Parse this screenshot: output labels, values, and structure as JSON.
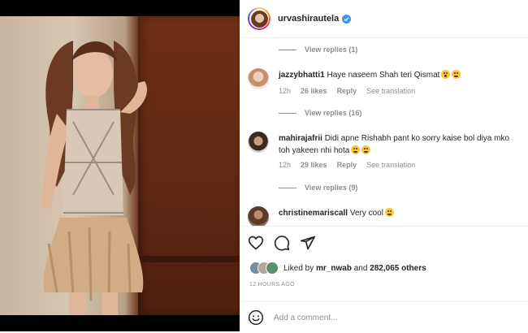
{
  "post": {
    "username": "urvashirautela",
    "verified": true,
    "liked_by_prefix": "Liked by",
    "liked_by_user": "mr_nwab",
    "liked_by_and": "and",
    "liked_by_others": "282,065 others",
    "timestamp": "12 HOURS AGO"
  },
  "comments": [
    {
      "type": "replies",
      "label": "View replies (1)"
    },
    {
      "type": "comment",
      "user": "jazzybhatti1",
      "text": "Haye naseem Shah teri Qismat",
      "emojis": [
        "astonished-emoji-icon",
        "grin-emoji-icon"
      ],
      "time": "12h",
      "likes": "26 likes",
      "reply": "Reply",
      "translate": "See translation"
    },
    {
      "type": "replies",
      "label": "View replies (16)"
    },
    {
      "type": "comment",
      "user": "mahirajafrii",
      "text": "Didi apne Rishabh pant ko sorry kaise bol diya mko toh yakeen nhi hota",
      "emojis": [
        "grin-emoji-icon",
        "grin-emoji-icon"
      ],
      "time": "12h",
      "likes": "29 likes",
      "reply": "Reply",
      "translate": "See translation"
    },
    {
      "type": "replies",
      "label": "View replies (9)"
    },
    {
      "type": "comment",
      "user": "christinemariscall",
      "text": "Very cool",
      "emojis": [
        "grin-emoji-icon"
      ]
    }
  ],
  "add_comment": {
    "placeholder": "Add a comment..."
  },
  "icons": {
    "like": "heart-icon",
    "comment": "comment-icon",
    "share": "send-icon",
    "emoji": "smiley-icon",
    "verified": "verified-badge-icon"
  },
  "colors": {
    "verified": "#3897f0",
    "muted": "#8e8e8e",
    "text": "#262626"
  }
}
